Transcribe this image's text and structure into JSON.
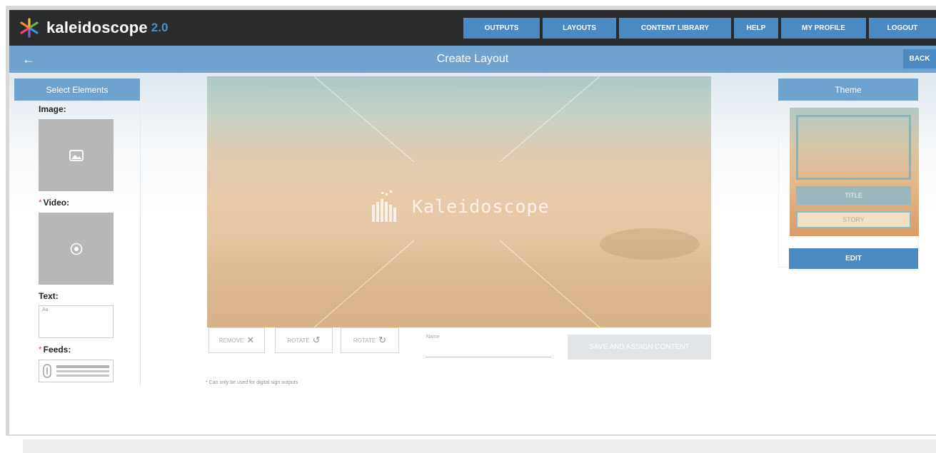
{
  "app": {
    "name": "kaleidoscope",
    "version": "2.0"
  },
  "nav": {
    "items": [
      {
        "label": "OUTPUTS"
      },
      {
        "label": "LAYOUTS"
      },
      {
        "label": "CONTENT LIBRARY"
      },
      {
        "label": "HELP"
      },
      {
        "label": "MY PROFILE"
      },
      {
        "label": "LOGOUT"
      }
    ]
  },
  "subheader": {
    "back_arrow": "←",
    "title": "Create Layout",
    "back_label": "BACK"
  },
  "elements_panel": {
    "title": "Select Elements",
    "image_label": "Image:",
    "video_label": "Video:",
    "text_label": "Text:",
    "text_sample": "Aa",
    "feeds_label": "Feeds:",
    "required_marker": "*"
  },
  "canvas": {
    "watermark": "Kaleidoscope"
  },
  "controls": {
    "remove_label": "REMOVE",
    "rotate_left_label": "ROTATE",
    "rotate_right_label": "ROTATE",
    "name_label": "Name",
    "name_value": "",
    "save_label": "SAVE AND ASSIGN CONTENT",
    "footnote": "* Can only be used for digital sign outputs"
  },
  "theme_panel": {
    "title": "Theme",
    "title_slot": "TITLE",
    "story_slot": "STORY",
    "edit_label": "EDIT"
  },
  "colors": {
    "topbar": "#2a2b2d",
    "accent": "#4a89c2",
    "subbar": "#6ea2cf",
    "required": "#d9534f"
  }
}
